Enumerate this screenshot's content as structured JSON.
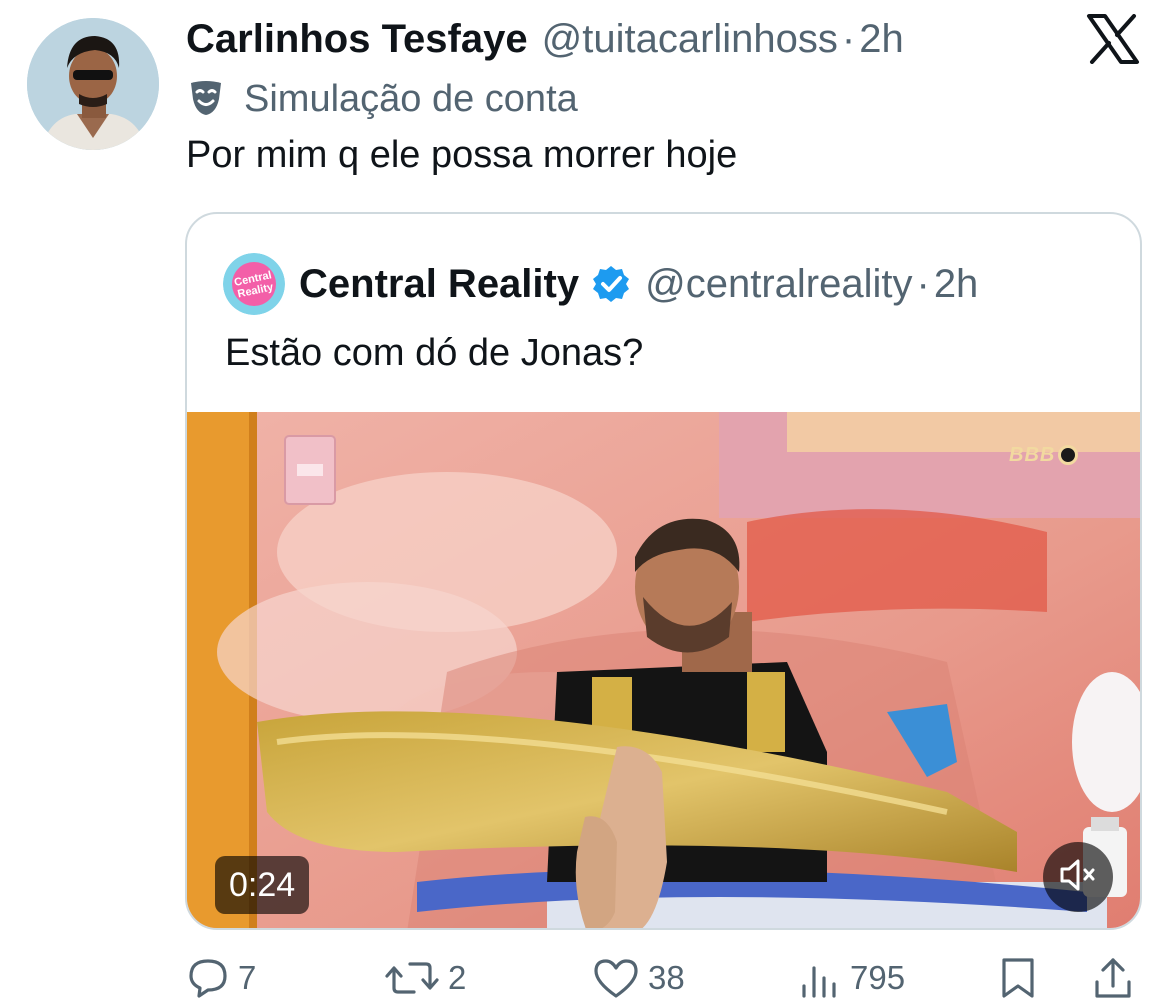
{
  "tweet": {
    "author_name": "Carlinhos Tesfaye",
    "author_handle": "@tuitacarlinhoss",
    "separator": "·",
    "time": "2h",
    "label_icon": "theater-masks-icon",
    "account_label": "Simulação de conta",
    "text": "Por mim q ele possa morrer hoje"
  },
  "quote": {
    "author_name": "Central Reality",
    "avatar_text_line1": "Central",
    "avatar_text_line2": "Reality",
    "verified_icon": "verified-badge-icon",
    "author_handle": "@centralreality",
    "separator": "·",
    "time": "2h",
    "text": "Estão com dó de Jonas?",
    "video": {
      "duration": "0:24",
      "watermark": "BBB",
      "mute_icon": "speaker-muted-icon"
    }
  },
  "actions": {
    "replies": "7",
    "reposts": "2",
    "likes": "38",
    "views": "795"
  },
  "brand": {
    "logo": "x-logo-icon",
    "text_primary": "#0f1419",
    "text_secondary": "#536471",
    "verified_blue": "#1d9bf0",
    "border": "#cfd9de"
  }
}
